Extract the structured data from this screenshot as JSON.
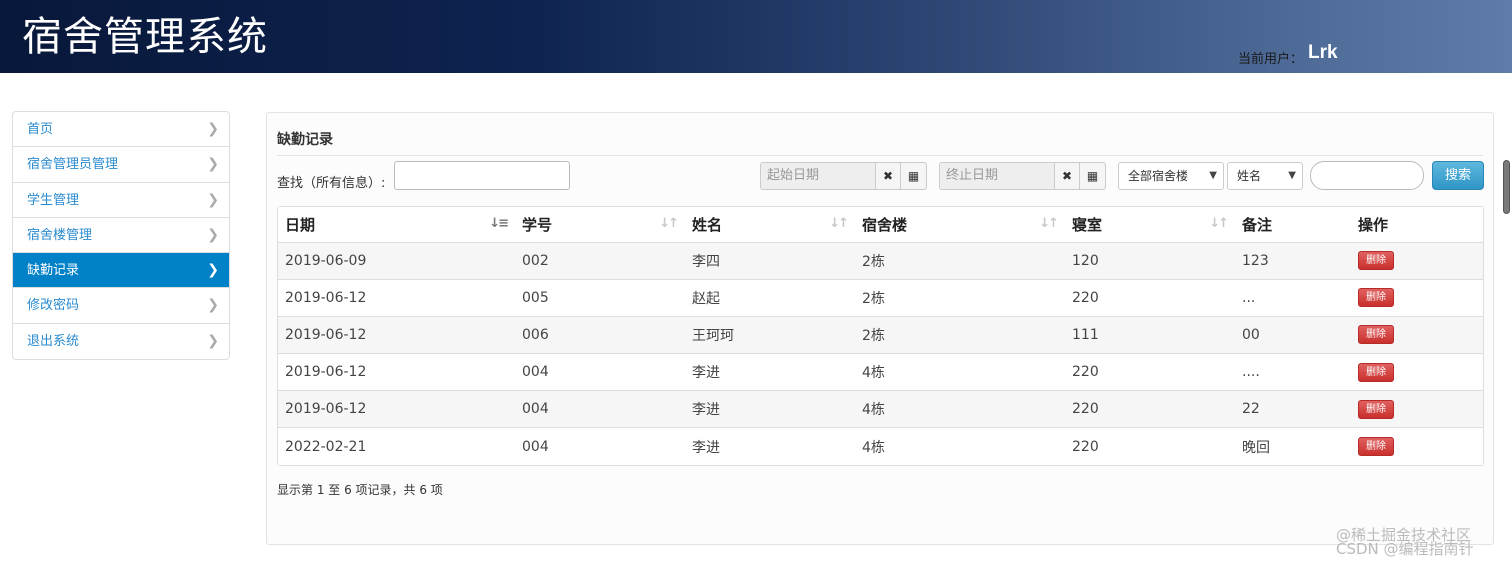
{
  "header": {
    "title": "宿舍管理系统",
    "user_label": "当前用户：",
    "user_name": "Lrk"
  },
  "sidebar": {
    "items": [
      {
        "label": "首页",
        "active": false
      },
      {
        "label": "宿舍管理员管理",
        "active": false
      },
      {
        "label": "学生管理",
        "active": false
      },
      {
        "label": "宿舍楼管理",
        "active": false
      },
      {
        "label": "缺勤记录",
        "active": true
      },
      {
        "label": "修改密码",
        "active": false
      },
      {
        "label": "退出系统",
        "active": false
      }
    ],
    "chevron_icon": "chevron-right-icon",
    "active_color": "#0081c8"
  },
  "panel": {
    "title": "缺勤记录",
    "search": {
      "label": "查找（所有信息）:",
      "value": ""
    },
    "start_date": {
      "placeholder": "起始日期",
      "clear_icon": "✖",
      "calendar_icon": "▦"
    },
    "end_date": {
      "placeholder": "终止日期",
      "clear_icon": "✖",
      "calendar_icon": "▦"
    },
    "building_select": {
      "selected": "全部宿舍楼"
    },
    "field_select": {
      "selected": "姓名"
    },
    "keyword": {
      "value": ""
    },
    "search_button": "搜索",
    "search_button_color": "#2f96c7"
  },
  "table": {
    "columns": [
      "日期",
      "学号",
      "姓名",
      "宿舍楼",
      "寝室",
      "备注",
      "操作"
    ],
    "rows": [
      {
        "date": "2019-06-09",
        "id": "002",
        "name": "李四",
        "building": "2栋",
        "room": "120",
        "note": "123",
        "action": "删除"
      },
      {
        "date": "2019-06-12",
        "id": "005",
        "name": "赵起",
        "building": "2栋",
        "room": "220",
        "note": "...",
        "action": "删除"
      },
      {
        "date": "2019-06-12",
        "id": "006",
        "name": "王珂珂",
        "building": "2栋",
        "room": "111",
        "note": "00",
        "action": "删除"
      },
      {
        "date": "2019-06-12",
        "id": "004",
        "name": "李进",
        "building": "4栋",
        "room": "220",
        "note": "....",
        "action": "删除"
      },
      {
        "date": "2019-06-12",
        "id": "004",
        "name": "李进",
        "building": "4栋",
        "room": "220",
        "note": "22",
        "action": "删除"
      },
      {
        "date": "2022-02-21",
        "id": "004",
        "name": "李进",
        "building": "4栋",
        "room": "220",
        "note": "晚回",
        "action": "删除"
      }
    ],
    "summary": "显示第 1 至 6 项记录，共 6 项",
    "delete_color": "#c9302c"
  },
  "watermark": "@稀土掘金技术社区\nCSDN @编程指南针"
}
